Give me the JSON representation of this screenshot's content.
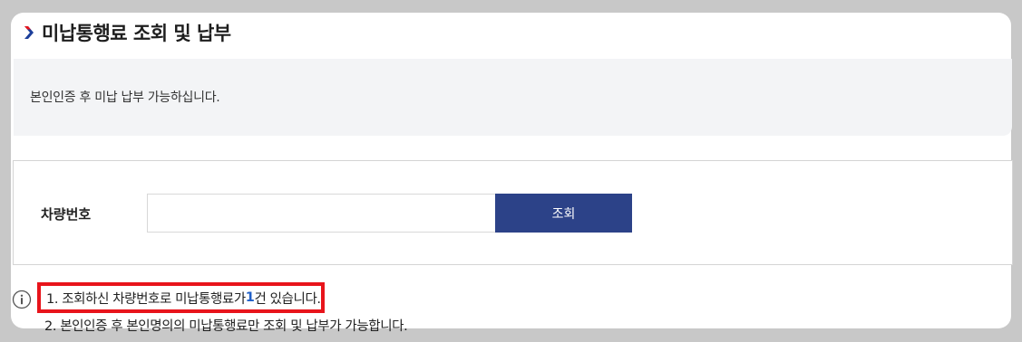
{
  "page": {
    "title": "미납통행료 조회 및 납부"
  },
  "notice": {
    "text": "본인인증 후 미납 납부 가능하십니다."
  },
  "form": {
    "label": "차량번호",
    "input_value": "",
    "input_placeholder": "",
    "search_label": "조회"
  },
  "result": {
    "prefix": "1. 조회하신 차량번호로 미납통행료가 ",
    "count": "1",
    "suffix": "건 있습니다."
  },
  "notes": {
    "line2": "2. 본인인증 후 본인명의의 미납통행료만 조회 및 납부가 가능합니다."
  },
  "colors": {
    "accent": "#2c4288",
    "highlight_border": "#e8141b",
    "count_color": "#2060c8",
    "chevron_blue": "#1d3f9a",
    "chevron_red": "#e8141b"
  },
  "icons": {
    "title_marker": "chevron-right-icon",
    "info": "info-icon"
  }
}
